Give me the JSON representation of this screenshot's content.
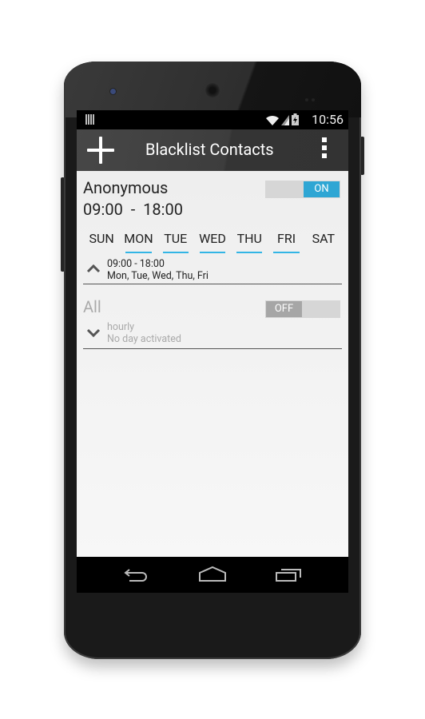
{
  "status_bar": {
    "time": "10:56",
    "icons": [
      "notification-icon",
      "wifi-icon",
      "signal-icon",
      "battery-charging-icon"
    ]
  },
  "action_bar": {
    "title": "Blacklist Contacts",
    "add_icon": "plus-icon",
    "menu_icon": "overflow-menu-icon"
  },
  "rules": [
    {
      "name": "Anonymous",
      "hours": "09:00  -  18:00",
      "toggle": {
        "state": "ON",
        "on": true
      },
      "expanded": true,
      "days": [
        {
          "label": "SUN",
          "active": false
        },
        {
          "label": "MON",
          "active": true
        },
        {
          "label": "TUE",
          "active": true
        },
        {
          "label": "WED",
          "active": true
        },
        {
          "label": "THU",
          "active": true
        },
        {
          "label": "FRI",
          "active": true
        },
        {
          "label": "SAT",
          "active": false
        }
      ],
      "summary_line1": "09:00 - 18:00",
      "summary_line2": "Mon, Tue, Wed, Thu, Fri"
    },
    {
      "name": "All",
      "toggle": {
        "state": "OFF",
        "on": false
      },
      "expanded": false,
      "summary_line1": "hourly",
      "summary_line2": "No day activated"
    }
  ],
  "nav_bar": {
    "buttons": [
      "back-icon",
      "home-icon",
      "recent-apps-icon"
    ]
  },
  "colors": {
    "accent": "#33b5e5",
    "toggle_on": "#2ea6d4",
    "toggle_off": "#a6a6a6",
    "disabled_text": "#aaaaaa"
  }
}
